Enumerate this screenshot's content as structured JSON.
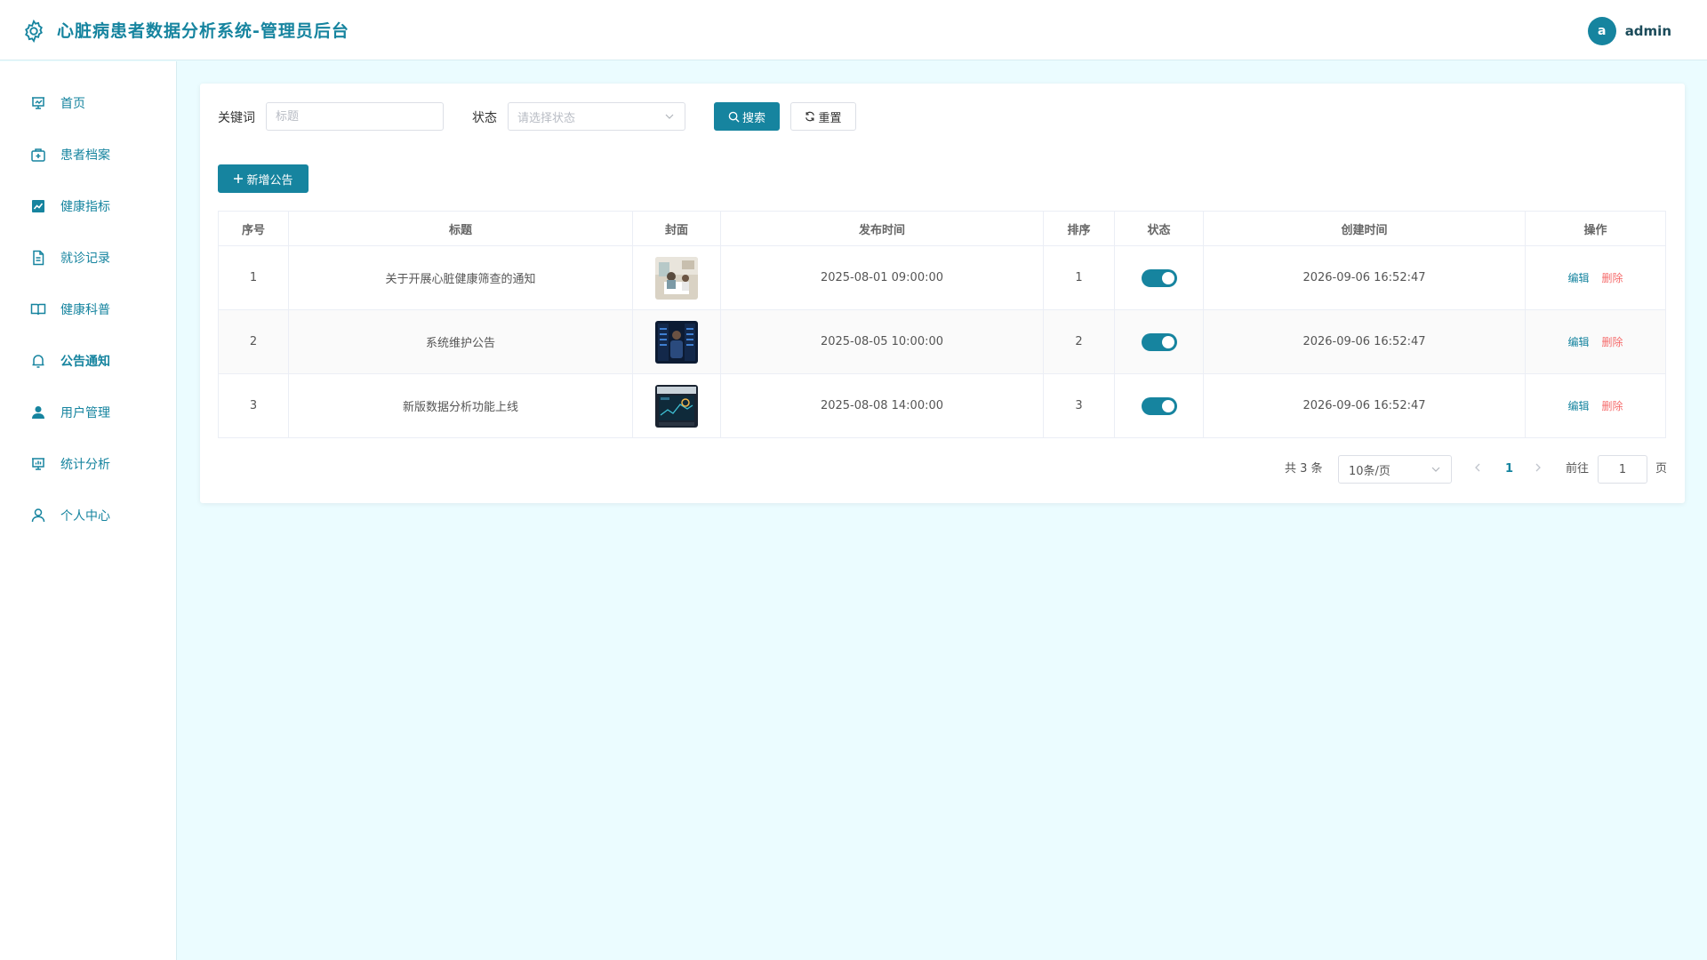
{
  "header": {
    "app_title": "心脏病患者数据分析系统-管理员后台",
    "user": {
      "avatar_letter": "a",
      "username": "admin"
    }
  },
  "sidebar": {
    "items": [
      {
        "label": "首页",
        "icon": "dashboard-icon"
      },
      {
        "label": "患者档案",
        "icon": "medical-kit-icon"
      },
      {
        "label": "健康指标",
        "icon": "trend-chart-icon"
      },
      {
        "label": "就诊记录",
        "icon": "document-icon"
      },
      {
        "label": "健康科普",
        "icon": "book-icon"
      },
      {
        "label": "公告通知",
        "icon": "bell-icon",
        "active": true
      },
      {
        "label": "用户管理",
        "icon": "user-filled-icon"
      },
      {
        "label": "统计分析",
        "icon": "presentation-chart-icon"
      },
      {
        "label": "个人中心",
        "icon": "user-icon"
      }
    ]
  },
  "filters": {
    "keyword_label": "关键词",
    "keyword_placeholder": "标题",
    "keyword_value": "",
    "status_label": "状态",
    "status_placeholder": "请选择状态",
    "search_label": "搜索",
    "reset_label": "重置"
  },
  "toolbar": {
    "add_label": "新增公告"
  },
  "table": {
    "columns": [
      "序号",
      "标题",
      "封面",
      "发布时间",
      "排序",
      "状态",
      "创建时间",
      "操作"
    ],
    "rows": [
      {
        "index": "1",
        "title": "关于开展心脏健康筛查的通知",
        "cover": "clinic-photo",
        "publish_time": "2025-08-01 09:00:00",
        "sort": "1",
        "status": true,
        "created": "2026-09-06 16:52:47"
      },
      {
        "index": "2",
        "title": "系统维护公告",
        "cover": "server-room-photo",
        "publish_time": "2025-08-05 10:00:00",
        "sort": "2",
        "status": true,
        "created": "2026-09-06 16:52:47"
      },
      {
        "index": "3",
        "title": "新版数据分析功能上线",
        "cover": "dashboard-screen-photo",
        "publish_time": "2025-08-08 14:00:00",
        "sort": "3",
        "status": true,
        "created": "2026-09-06 16:52:47"
      }
    ],
    "edit_label": "编辑",
    "delete_label": "删除"
  },
  "pagination": {
    "total_text": "共 3 条",
    "page_size": "10条/页",
    "current_page": "1",
    "goto_label": "前往",
    "goto_value": "1",
    "page_suffix": "页"
  },
  "colors": {
    "primary": "#16849f",
    "danger": "#f56c6c",
    "background": "#ebfcff"
  }
}
